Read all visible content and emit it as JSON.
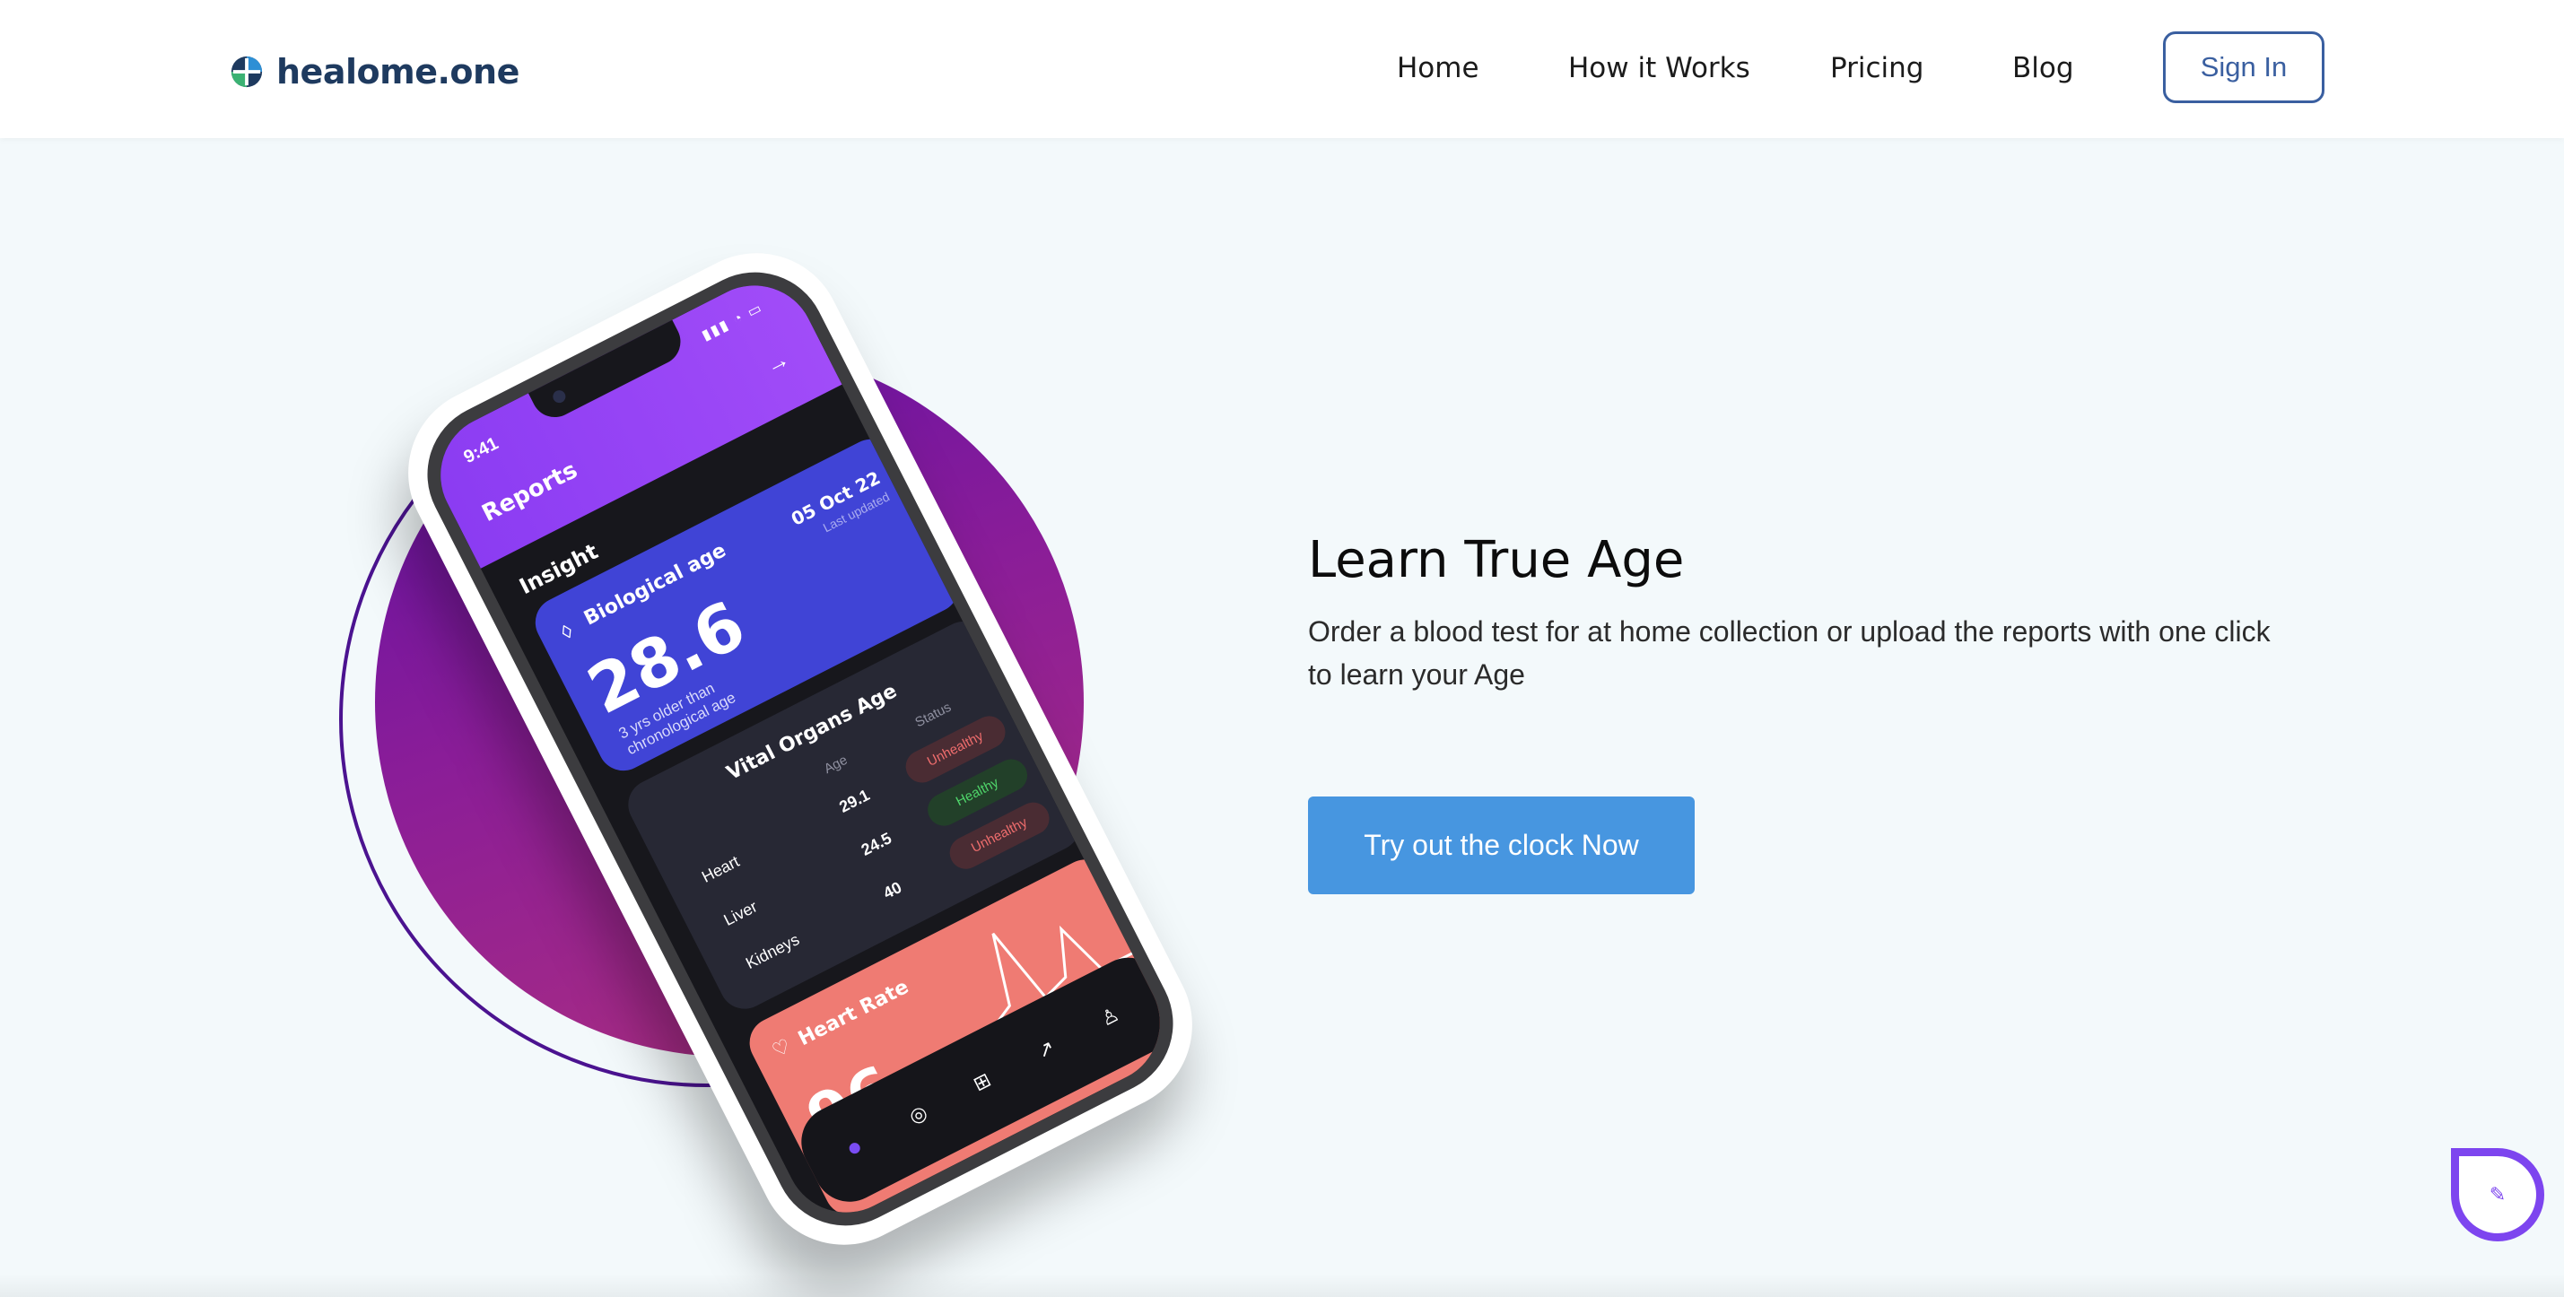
{
  "brand": {
    "name": "healome.one"
  },
  "nav": {
    "items": [
      {
        "label": "Home"
      },
      {
        "label": "How it Works"
      },
      {
        "label": "Pricing"
      },
      {
        "label": "Blog"
      }
    ],
    "signin_label": "Sign In"
  },
  "hero": {
    "title": "Learn True Age",
    "subtitle": "Order a blood test for at home collection or upload the reports with one click to learn your Age",
    "cta_label": "Try out the clock Now"
  },
  "phone": {
    "status_time": "9:41",
    "header_title": "Reports",
    "section_title": "Insight",
    "bio_card": {
      "label": "Biological age",
      "value": "28.6",
      "note": "3 yrs older than chronological age",
      "date": "05 Oct 22",
      "updated_label": "Last updated"
    },
    "organs_card": {
      "title": "Vital Organs Age",
      "col_age": "Age",
      "col_status": "Status",
      "rows": [
        {
          "name": "Heart",
          "age": "29.1",
          "status": "Unhealthy"
        },
        {
          "name": "Liver",
          "age": "24.5",
          "status": "Healthy"
        },
        {
          "name": "Kidneys",
          "age": "40",
          "status": "Unhealthy"
        }
      ]
    },
    "heart_card": {
      "label": "Heart Rate",
      "value": "96"
    },
    "tabs": [
      "home-icon",
      "activity-icon",
      "add-icon",
      "trend-icon",
      "profile-icon"
    ]
  },
  "colors": {
    "accent_purple": "#8b3cf2",
    "cta_blue": "#4796e0",
    "signin_border": "#3a5fa0",
    "healthy": "#4fd46a",
    "unhealthy": "#ef6d6d"
  }
}
